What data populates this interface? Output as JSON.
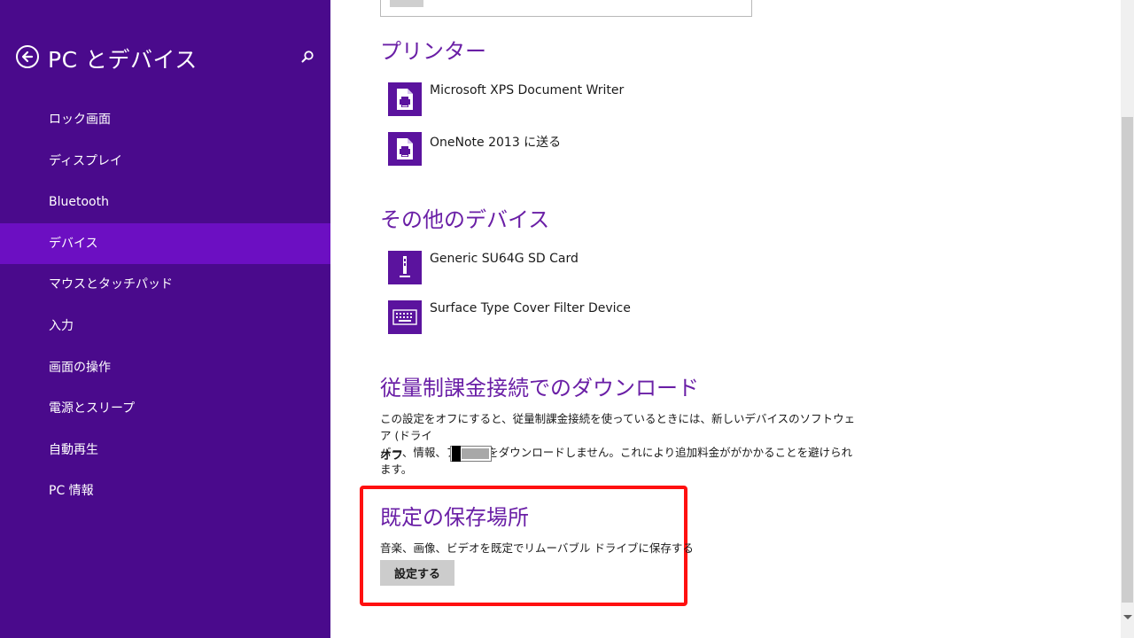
{
  "sidebar": {
    "title": "PC とデバイス",
    "back_icon": "back-arrow-icon",
    "search_icon": "search-icon",
    "items": [
      {
        "label": "ロック画面"
      },
      {
        "label": "ディスプレイ"
      },
      {
        "label": "Bluetooth"
      },
      {
        "label": "デバイス",
        "active": true
      },
      {
        "label": "マウスとタッチパッド"
      },
      {
        "label": "入力"
      },
      {
        "label": "画面の操作"
      },
      {
        "label": "電源とスリープ"
      },
      {
        "label": "自動再生"
      },
      {
        "label": "PC 情報"
      }
    ]
  },
  "printers": {
    "title": "プリンター",
    "devices": [
      {
        "label": "Microsoft XPS Document Writer",
        "icon": "printer-icon"
      },
      {
        "label": "OneNote 2013 に送る",
        "icon": "printer-icon"
      }
    ]
  },
  "other_devices": {
    "title": "その他のデバイス",
    "devices": [
      {
        "label": "Generic SU64G SD Card",
        "icon": "usb-drive-icon"
      },
      {
        "label": "Surface Type Cover Filter Device",
        "icon": "keyboard-icon"
      }
    ]
  },
  "metered": {
    "title": "従量制課金接続でのダウンロード",
    "description_line1": "この設定をオフにすると、従量制課金接続を使っているときには、新しいデバイスのソフトウェア (ドライ",
    "description_line2": "バー、情報、アプリ) をダウンロードしません。これにより追加料金ががかかることを避けられます。",
    "toggle_label": "オフ",
    "toggle_on": false
  },
  "default_save": {
    "title": "既定の保存場所",
    "description": "音楽、画像、ビデオを既定でリムーバブル ドライブに保存する",
    "button_label": "設定する"
  },
  "colors": {
    "sidebar_bg": "#4a0a8c",
    "sidebar_active": "#6c0fc2",
    "accent": "#6a1fa6",
    "icon_bg": "#5b139e",
    "highlight": "#ff1010"
  }
}
